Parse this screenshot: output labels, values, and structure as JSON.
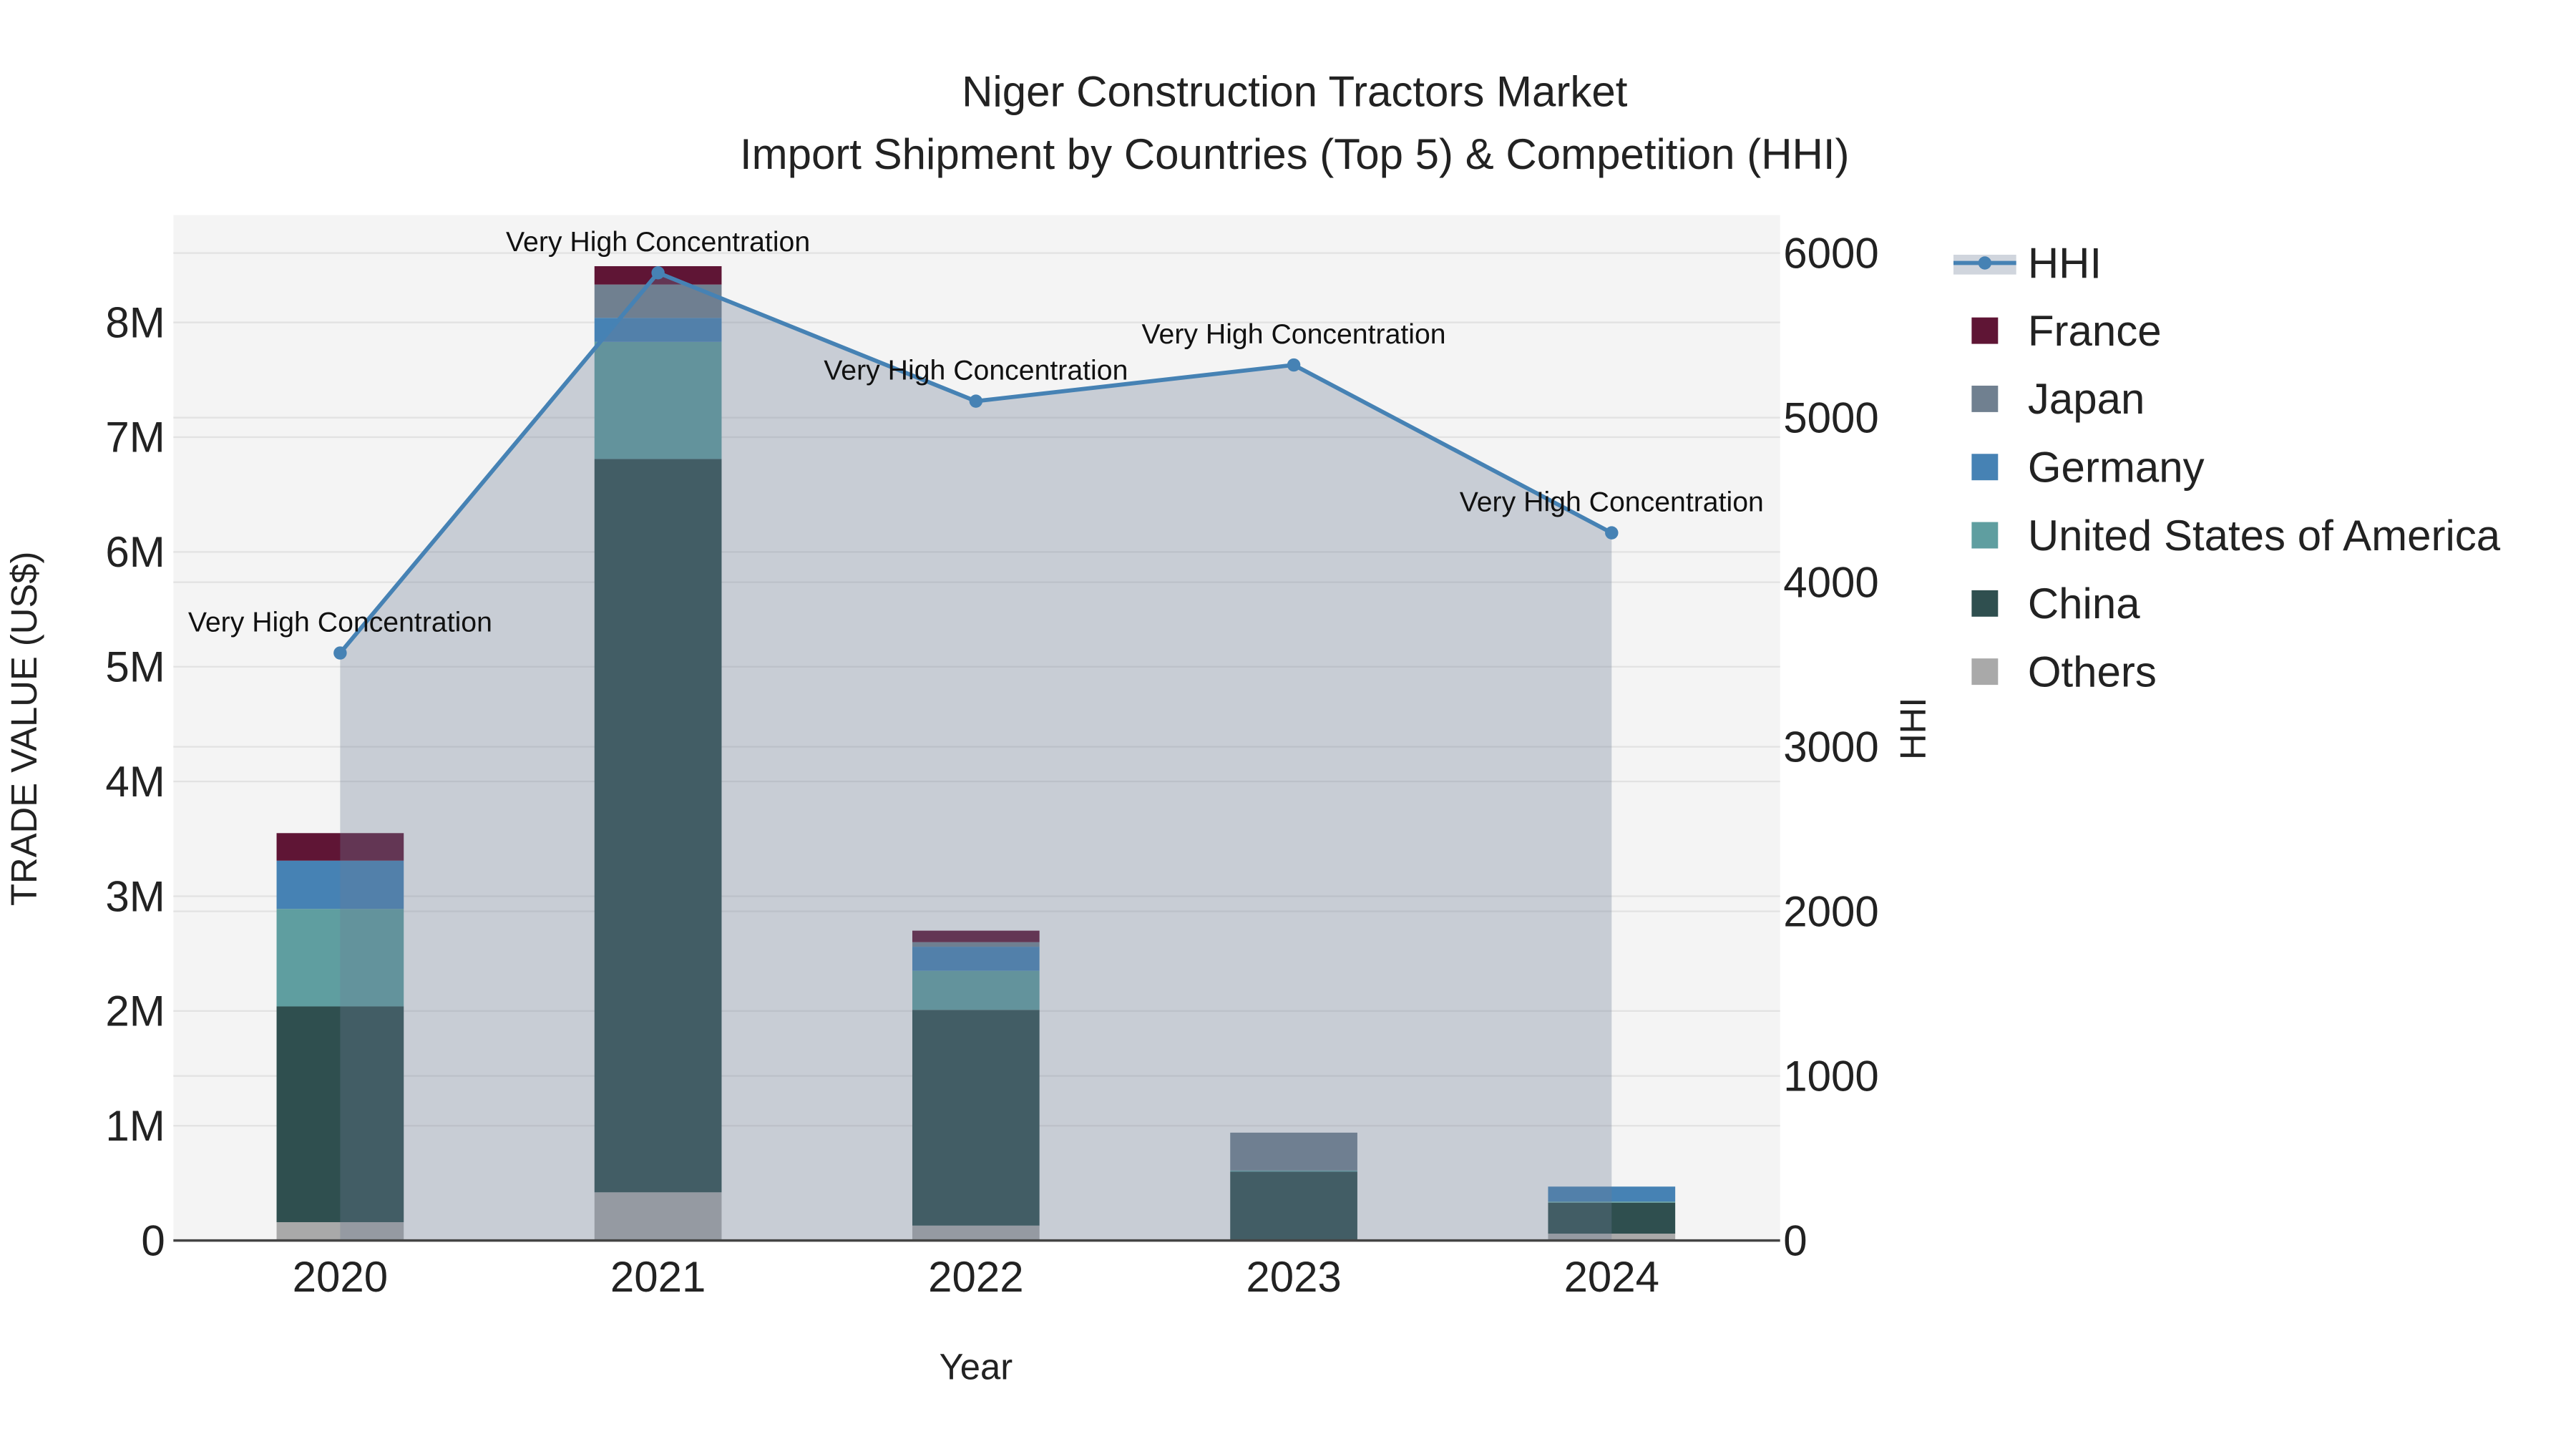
{
  "chart_data": {
    "type": "bar",
    "title": "Niger Construction Tractors Market",
    "subtitle": "Import Shipment by Countries (Top 5) & Competition (HHI)",
    "xlabel": "Year",
    "ylabel": "TRADE VALUE (US$)",
    "y2label": "HHI",
    "categories": [
      "2020",
      "2021",
      "2022",
      "2023",
      "2024"
    ],
    "ylim": [
      0,
      8800000
    ],
    "y2lim": [
      0,
      6200
    ],
    "yticks": [
      {
        "v": 0,
        "label": "0"
      },
      {
        "v": 1000000,
        "label": "1M"
      },
      {
        "v": 2000000,
        "label": "2M"
      },
      {
        "v": 3000000,
        "label": "3M"
      },
      {
        "v": 4000000,
        "label": "4M"
      },
      {
        "v": 5000000,
        "label": "5M"
      },
      {
        "v": 6000000,
        "label": "6M"
      },
      {
        "v": 7000000,
        "label": "7M"
      },
      {
        "v": 8000000,
        "label": "8M"
      }
    ],
    "y2ticks": [
      {
        "v": 0,
        "label": "0"
      },
      {
        "v": 1000,
        "label": "1000"
      },
      {
        "v": 2000,
        "label": "2000"
      },
      {
        "v": 3000,
        "label": "3000"
      },
      {
        "v": 4000,
        "label": "4000"
      },
      {
        "v": 5000,
        "label": "5000"
      },
      {
        "v": 6000,
        "label": "6000"
      }
    ],
    "series": [
      {
        "name": "Others",
        "color": "#a9a9a9",
        "values": [
          160000,
          420000,
          130000,
          0,
          60000
        ]
      },
      {
        "name": "China",
        "color": "#2f4f4f",
        "values": [
          1880000,
          6390000,
          1880000,
          600000,
          270000
        ]
      },
      {
        "name": "United States of America",
        "color": "#5f9ea0",
        "values": [
          850000,
          1020000,
          340000,
          10000,
          10000
        ]
      },
      {
        "name": "Germany",
        "color": "#4682b4",
        "values": [
          420000,
          210000,
          210000,
          0,
          130000
        ]
      },
      {
        "name": "Japan",
        "color": "#708090",
        "values": [
          0,
          290000,
          40000,
          330000,
          0
        ]
      },
      {
        "name": "France",
        "color": "#5f1535",
        "values": [
          240000,
          160000,
          100000,
          0,
          0
        ]
      }
    ],
    "hhi": {
      "name": "HHI",
      "color": "#4682b4",
      "values": [
        3570,
        5880,
        5100,
        5320,
        4300
      ]
    },
    "annotations": [
      "Very High Concentration",
      "Very High Concentration",
      "Very High Concentration",
      "Very High Concentration",
      "Very High Concentration"
    ],
    "legend_order": [
      "HHI",
      "France",
      "Japan",
      "Germany",
      "United States of America",
      "China",
      "Others"
    ],
    "legend_position": "right",
    "grid": true
  }
}
